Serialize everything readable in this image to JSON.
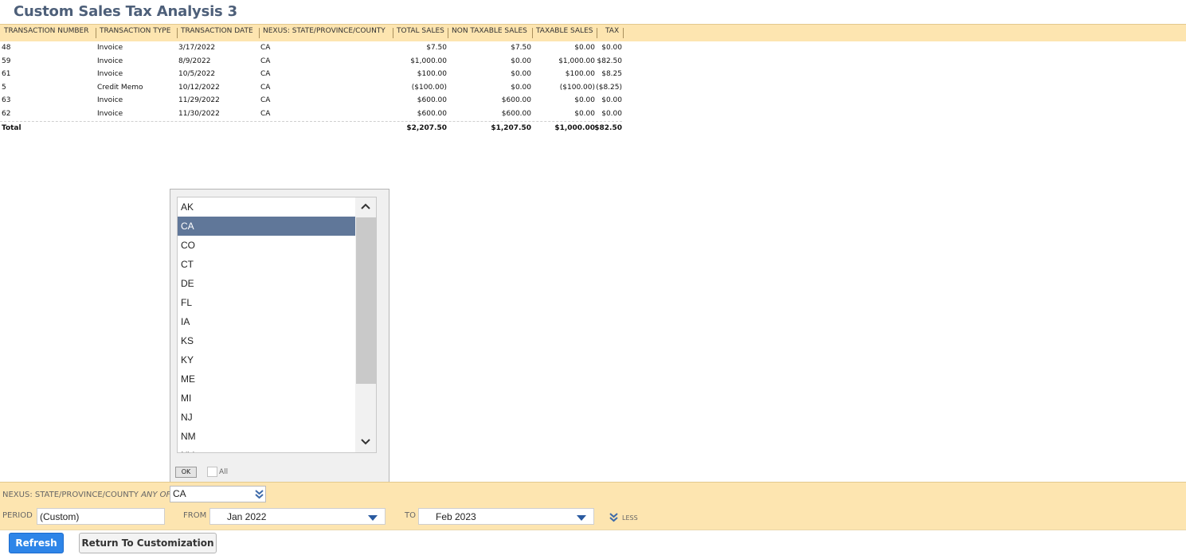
{
  "page": {
    "title": "Custom Sales Tax Analysis 3"
  },
  "report": {
    "columns": [
      "TRANSACTION NUMBER",
      "TRANSACTION TYPE",
      "TRANSACTION DATE",
      "NEXUS: STATE/PROVINCE/COUNTY",
      "TOTAL SALES",
      "NON TAXABLE SALES",
      "TAXABLE SALES",
      "TAX"
    ],
    "rows": [
      [
        "48",
        "Invoice",
        "3/17/2022",
        "CA",
        "$7.50",
        "$7.50",
        "$0.00",
        "$0.00"
      ],
      [
        "59",
        "Invoice",
        "8/9/2022",
        "CA",
        "$1,000.00",
        "$0.00",
        "$1,000.00",
        "$82.50"
      ],
      [
        "61",
        "Invoice",
        "10/5/2022",
        "CA",
        "$100.00",
        "$0.00",
        "$100.00",
        "$8.25"
      ],
      [
        "5",
        "Credit Memo",
        "10/12/2022",
        "CA",
        "($100.00)",
        "$0.00",
        "($100.00)",
        "($8.25)"
      ],
      [
        "63",
        "Invoice",
        "11/29/2022",
        "CA",
        "$600.00",
        "$600.00",
        "$0.00",
        "$0.00"
      ],
      [
        "62",
        "Invoice",
        "11/30/2022",
        "CA",
        "$600.00",
        "$600.00",
        "$0.00",
        "$0.00"
      ]
    ],
    "total": {
      "label": "Total",
      "total_sales": "$2,207.50",
      "non_taxable": "$1,207.50",
      "taxable": "$1,000.00",
      "tax": "$82.50"
    }
  },
  "multiselect": {
    "options": [
      "AK",
      "CA",
      "CO",
      "CT",
      "DE",
      "FL",
      "IA",
      "KS",
      "KY",
      "ME",
      "MI",
      "NJ",
      "NM",
      "NV"
    ],
    "selected": "CA",
    "ok_label": "OK",
    "all_label": "All"
  },
  "filters": {
    "nexus_label": "NEXUS: STATE/PROVINCE/COUNTY",
    "nexus_operator": "ANY OF",
    "nexus_value": "CA",
    "period_label": "PERIOD",
    "period_value": "(Custom)",
    "from_label": "FROM",
    "from_value": "Jan 2022",
    "to_label": "TO",
    "to_value": "Feb 2023",
    "less_label": "LESS"
  },
  "buttons": {
    "refresh": "Refresh",
    "return": "Return To Customization"
  }
}
